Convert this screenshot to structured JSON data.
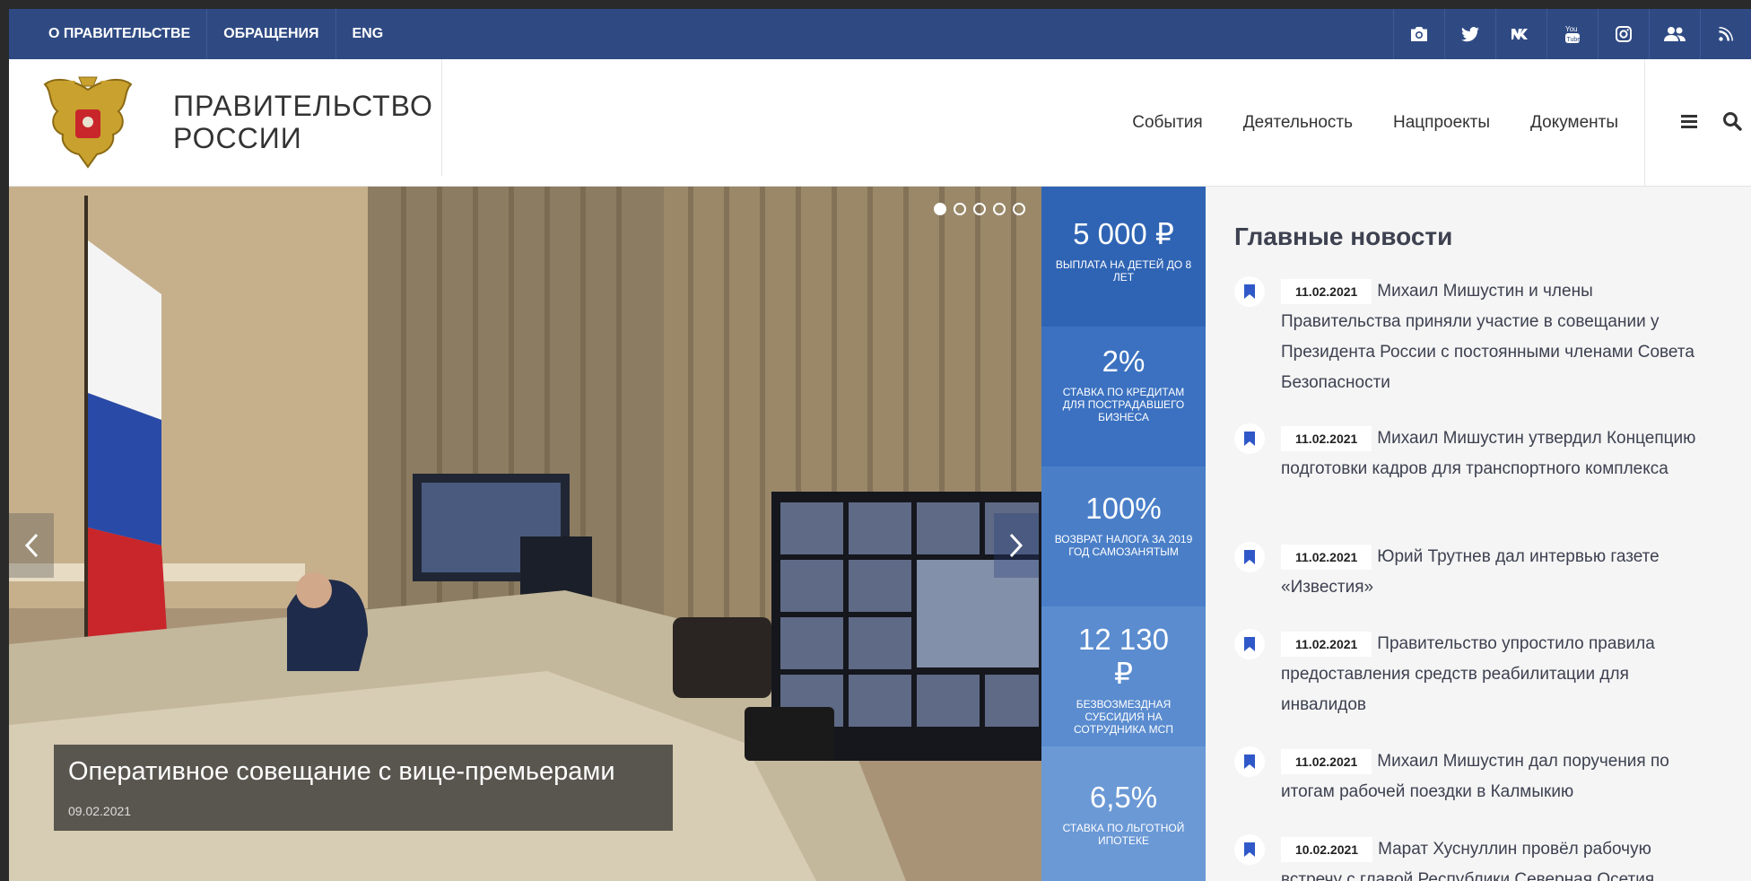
{
  "topbar": {
    "links": [
      "О ПРАВИТЕЛЬСТВЕ",
      "ОБРАЩЕНИЯ",
      "ENG"
    ],
    "social_icons": [
      "camera-icon",
      "twitter-icon",
      "vk-icon",
      "youtube-icon",
      "instagram-icon",
      "users-icon",
      "rss-icon"
    ]
  },
  "brand": {
    "line1": "ПРАВИТЕЛЬСТВО",
    "line2": "РОССИИ"
  },
  "nav": {
    "items": [
      "События",
      "Деятельность",
      "Нацпроекты",
      "Документы"
    ]
  },
  "slider": {
    "caption_title": "Оперативное совещание с вице-премьерами",
    "caption_date": "09.02.2021",
    "dots_count": 5,
    "active_dot": 1
  },
  "stats": [
    {
      "value": "5 000 ₽",
      "label": "ВЫПЛАТА НА ДЕТЕЙ ДО 8 ЛЕТ",
      "color": "#2f64b4"
    },
    {
      "value": "2%",
      "label": "СТАВКА ПО КРЕДИТАМ ДЛЯ ПОСТРАДАВШЕГО БИЗНЕСА",
      "color": "#3b71c0"
    },
    {
      "value": "100%",
      "label": "ВОЗВРАТ НАЛОГА ЗА 2019 ГОД САМОЗАНЯТЫМ",
      "color": "#4a7fc8"
    },
    {
      "value": "12 130 ₽",
      "label": "БЕЗВОЗМЕЗДНАЯ СУБСИДИЯ НА СОТРУДНИКА МСП",
      "color": "#5a8ccf"
    },
    {
      "value": "6,5%",
      "label": "СТАВКА ПО ЛЬГОТНОЙ ИПОТЕКЕ",
      "color": "#6b99d6"
    }
  ],
  "news": {
    "title": "Главные новости",
    "items": [
      {
        "date": "11.02.2021",
        "text": "Михаил Мишустин и члены Правительства приняли участие в совещании у Президента России с постоянными членами Совета Безопасности"
      },
      {
        "date": "11.02.2021",
        "text": "Михаил Мишустин утвердил Концепцию подготовки кадров для транспортного комплекса"
      },
      {
        "date": "11.02.2021",
        "text": "Юрий Трутнев дал интервью газете «Известия»"
      },
      {
        "date": "11.02.2021",
        "text": "Правительство упростило правила предоставления средств реабилитации для инвалидов"
      },
      {
        "date": "11.02.2021",
        "text": "Михаил Мишустин дал поручения по итогам рабочей поездки в Калмыкию"
      },
      {
        "date": "10.02.2021",
        "text": "Марат Хуснуллин провёл рабочую встречу с главой Республики Северная Осетия"
      }
    ]
  },
  "colors": {
    "topbar": "#2f4a83",
    "accent": "#3058c8",
    "news_bg": "#f5f5f5"
  }
}
